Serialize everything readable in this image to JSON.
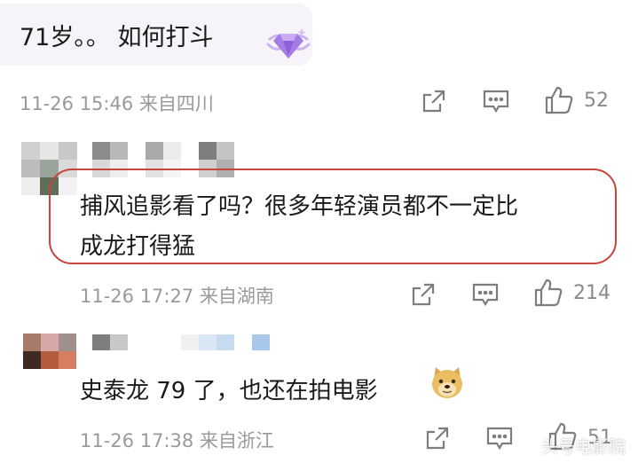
{
  "comments": [
    {
      "text": "71岁。。 如何打斗",
      "time": "11-26 15:46",
      "location": "来自四川",
      "likes": "52"
    },
    {
      "text_line1": "捕风追影看了吗？很多年轻演员都不一定比",
      "text_line2": "成龙打得猛",
      "time": "11-26 17:27",
      "location": "来自湖南",
      "likes": "214"
    },
    {
      "text": "史泰龙 79 了，也还在拍电影",
      "time": "11-26 17:38",
      "location": "来自浙江",
      "likes": "51"
    }
  ],
  "watermark": "头号电影院",
  "icons": {
    "share": "share-icon",
    "comment": "comment-icon",
    "like": "thumbs-up-icon",
    "badge": "diamond-badge-icon",
    "emoji": "doge-emoji-icon"
  },
  "colors": {
    "highlight_border": "#c8443d",
    "meta_text": "#9a9a9a",
    "badge_purple": "#a57be6"
  }
}
